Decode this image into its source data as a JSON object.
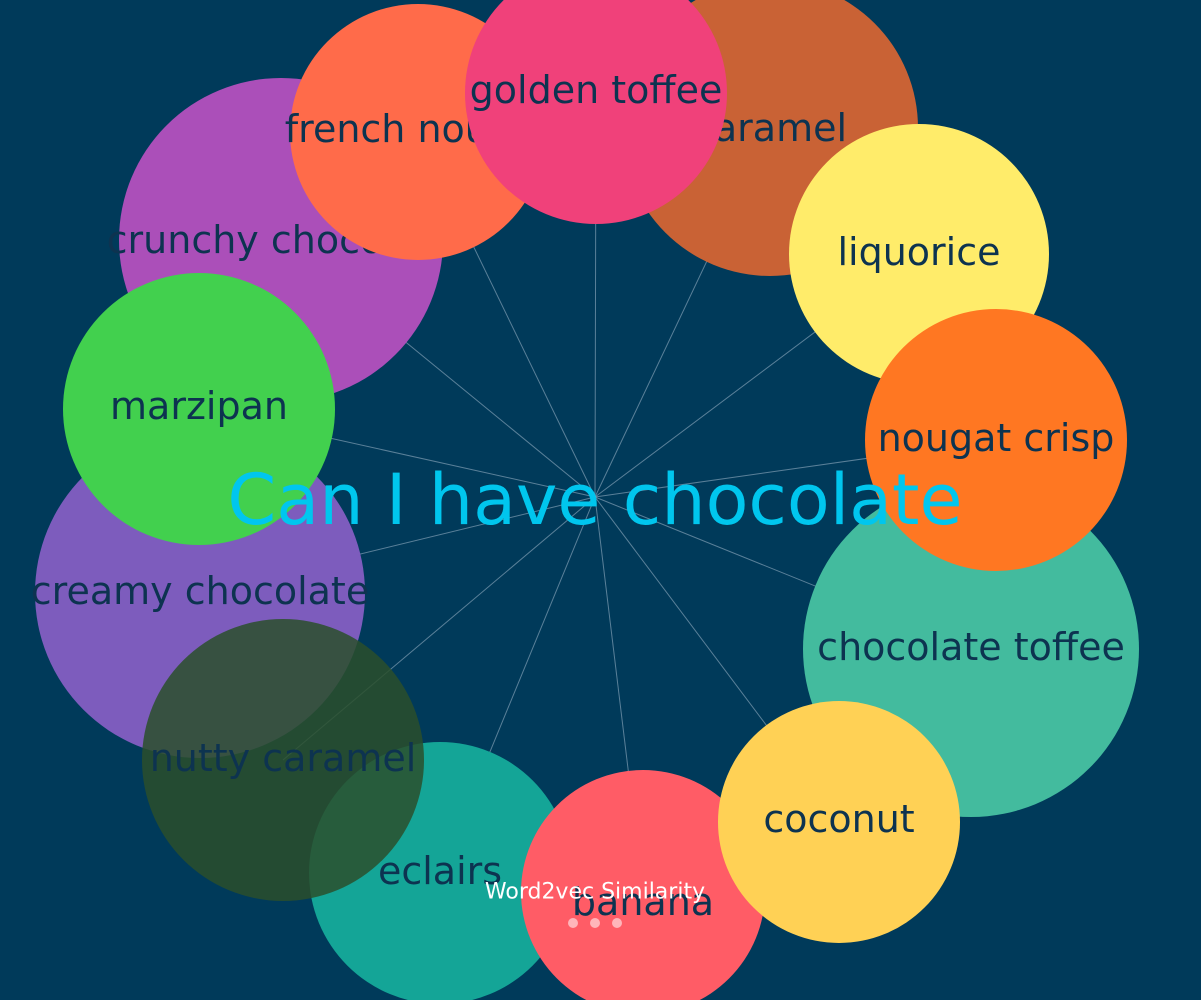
{
  "center": {
    "label": "Can I have chocolate",
    "color": "#00c6ee"
  },
  "caption": "Word2vec Similarity",
  "background_color": "#003a5a",
  "label_color": "#0d3350",
  "words": [
    {
      "id": "crunchy-chocolate",
      "label": "crunchy chocolate",
      "color": "#ab4fb9"
    },
    {
      "id": "caramel",
      "label": "caramel",
      "color": "#c96235"
    },
    {
      "id": "french-nougat",
      "label": "french nougat",
      "color": "#ff6b4a"
    },
    {
      "id": "golden-toffee",
      "label": "golden toffee",
      "color": "#f0417a"
    },
    {
      "id": "liquorice",
      "label": "liquorice",
      "color": "#ffec6a"
    },
    {
      "id": "nougat-crisp",
      "label": "nougat crisp",
      "color": "#ff7722"
    },
    {
      "id": "chocolate-toffee",
      "label": "chocolate toffee",
      "color": "#43bb9e"
    },
    {
      "id": "creamy-chocolate",
      "label": "creamy chocolate",
      "color": "#7d5cbd"
    },
    {
      "id": "marzipan",
      "label": "marzipan",
      "color": "#42d04e"
    },
    {
      "id": "nutty-caramel",
      "label": "nutty caramel",
      "color": "#2a4f2c"
    },
    {
      "id": "eclairs",
      "label": "eclairs",
      "color": "#14a597"
    },
    {
      "id": "banana",
      "label": "banana",
      "color": "#ff5c66"
    },
    {
      "id": "coconut",
      "label": "coconut",
      "color": "#ffd155"
    }
  ],
  "pager_dots": 3
}
